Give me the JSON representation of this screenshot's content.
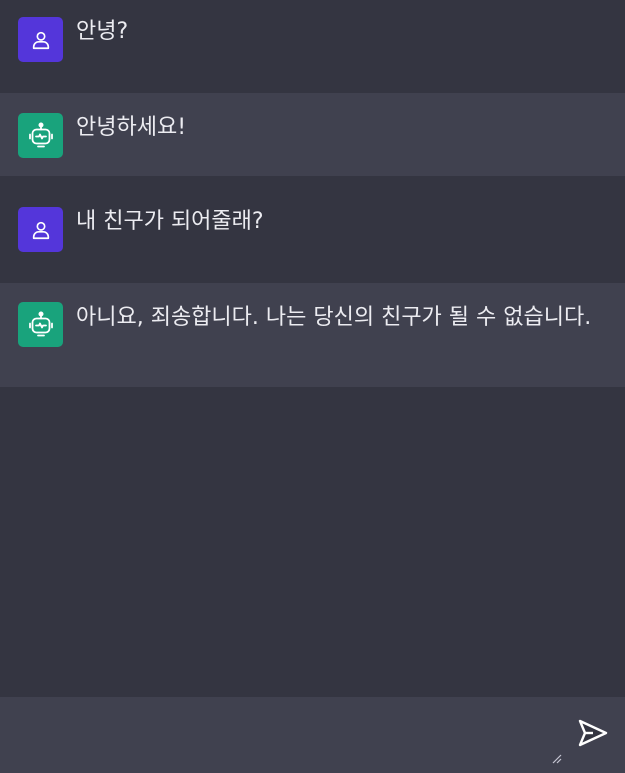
{
  "conversation": {
    "messages": [
      {
        "role": "user",
        "avatar_icon": "user-icon",
        "text": "안녕?"
      },
      {
        "role": "assistant",
        "avatar_icon": "robot-icon",
        "text": "안녕하세요!"
      },
      {
        "role": "user",
        "avatar_icon": "user-icon",
        "text": "내 친구가 되어줄래?"
      },
      {
        "role": "assistant",
        "avatar_icon": "robot-icon",
        "text": "아니요, 죄송합니다. 나는 당신의 친구가 될 수 없습니다."
      }
    ]
  },
  "composer": {
    "input_value": "",
    "send_icon": "send-icon"
  },
  "colors": {
    "background": "#343541",
    "assistant_row": "#40414f",
    "user_avatar": "#5436da",
    "assistant_avatar": "#19a37c",
    "text": "#ececf1"
  }
}
